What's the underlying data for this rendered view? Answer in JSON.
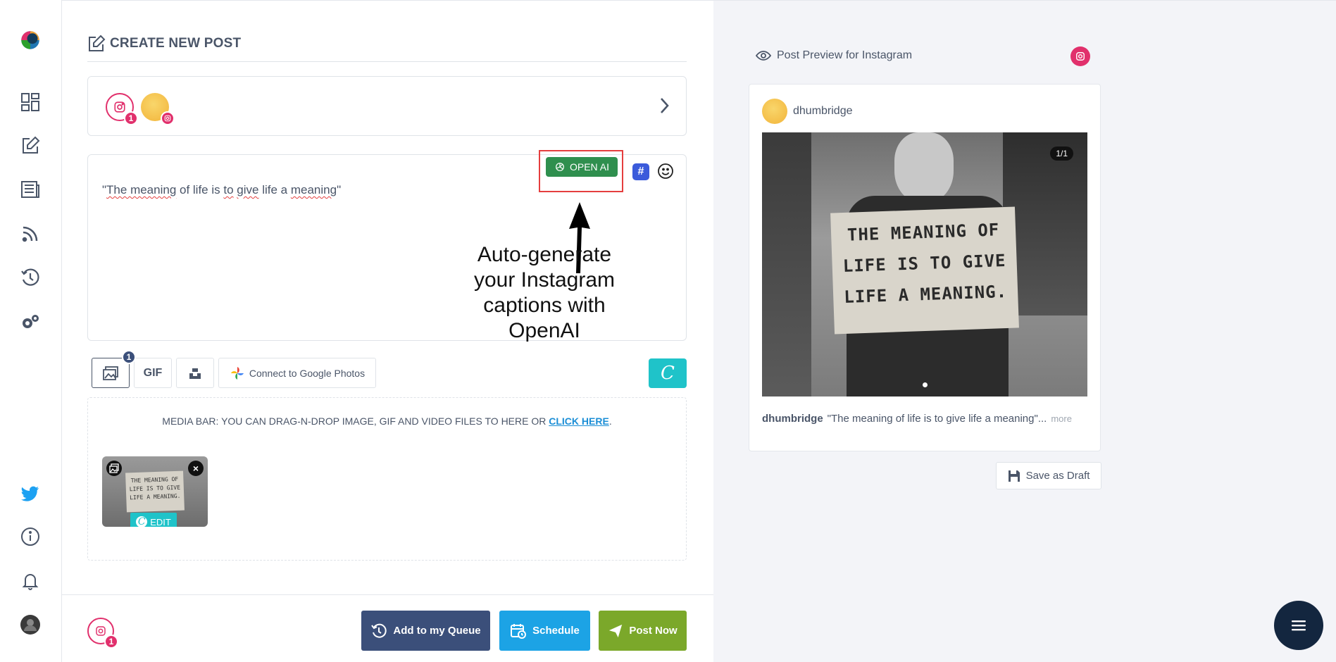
{
  "page": {
    "title": "CREATE NEW POST"
  },
  "sidebar": {
    "items": [
      {
        "icon": "dashboard-icon"
      },
      {
        "icon": "edit-icon"
      },
      {
        "icon": "posts-icon"
      },
      {
        "icon": "rss-icon"
      },
      {
        "icon": "history-icon"
      },
      {
        "icon": "settings-icon"
      },
      {
        "icon": "twitter-icon"
      },
      {
        "icon": "info-icon"
      },
      {
        "icon": "bell-icon"
      },
      {
        "icon": "avatar"
      }
    ]
  },
  "accounts": {
    "instagram_badge": "1"
  },
  "editor": {
    "text_parts": [
      "\"",
      "The meaning",
      " of life is ",
      "to",
      " ",
      "give",
      " life a ",
      "meaning",
      "\""
    ],
    "openai_label": "OPEN AI",
    "hashtag_label": "#"
  },
  "annotation": {
    "text_lines": [
      "Auto-generate",
      "your Instagram",
      "captions with",
      "OpenAI"
    ]
  },
  "tools": {
    "media_badge": "1",
    "gif_label": "GIF",
    "google_photos_label": "Connect to Google Photos",
    "canva_label": "C"
  },
  "media_bar": {
    "text": "MEDIA BAR: YOU CAN DRAG-N-DROP IMAGE, GIF AND VIDEO FILES TO HERE OR ",
    "link": "CLICK HERE",
    "suffix": ".",
    "thumb_sign": "THE MEANING OF LIFE IS TO GIVE LIFE A MEANING.",
    "remove_label": "×",
    "edit_label": "EDIT"
  },
  "footer": {
    "instagram_badge": "1",
    "queue_label": "Add to my Queue",
    "schedule_label": "Schedule",
    "post_label": "Post Now"
  },
  "preview": {
    "header": "Post Preview for Instagram",
    "username": "dhumbridge",
    "counter": "1/1",
    "sign_lines": [
      "THE MEANING OF",
      "LIFE IS TO GIVE",
      "LIFE A MEANING."
    ],
    "caption_user": "dhumbridge",
    "caption_text": "\"The meaning of life is to give life a meaning\"...",
    "more": "more",
    "draft_label": "Save as Draft"
  },
  "colors": {
    "instagram": "#e1306c",
    "openai_green": "#2f8f4e",
    "queue": "#3b4f7a",
    "schedule": "#1ca3e5",
    "post_now": "#7ba82a",
    "canva": "#1fc3c9",
    "annotation_red": "#e53e3e"
  }
}
